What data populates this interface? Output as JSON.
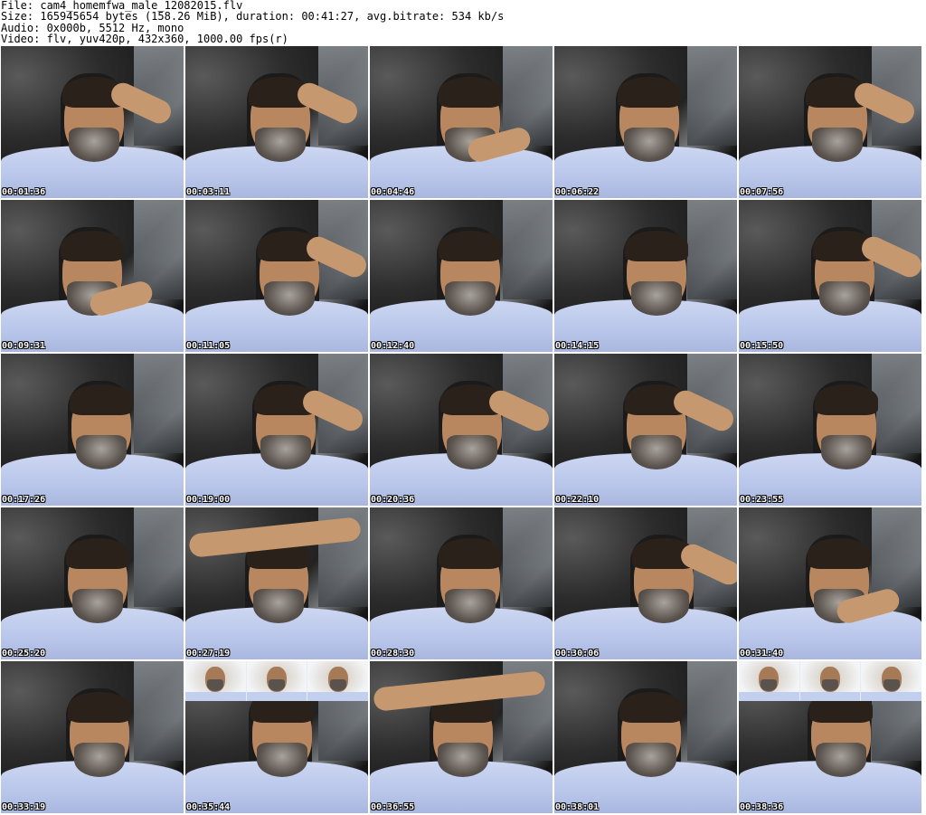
{
  "header": {
    "line1": "File: cam4_homemfwa_male_12082015.flv",
    "line2": "Size: 165945654 bytes (158.26 MiB), duration: 00:41:27, avg.bitrate: 534 kb/s",
    "line3": "Audio: 0x000b, 5512 Hz, mono",
    "line4": "Video: flv, yuv420p, 432x360, 1000.00 fps(r)"
  },
  "thumbnails": [
    {
      "timestamp": "00:01:36"
    },
    {
      "timestamp": "00:03:11"
    },
    {
      "timestamp": "00:04:46"
    },
    {
      "timestamp": "00:06:22"
    },
    {
      "timestamp": "00:07:56"
    },
    {
      "timestamp": "00:09:31"
    },
    {
      "timestamp": "00:11:05"
    },
    {
      "timestamp": "00:12:40"
    },
    {
      "timestamp": "00:14:15"
    },
    {
      "timestamp": "00:15:50"
    },
    {
      "timestamp": "00:17:26"
    },
    {
      "timestamp": "00:19:00"
    },
    {
      "timestamp": "00:20:36"
    },
    {
      "timestamp": "00:22:10"
    },
    {
      "timestamp": "00:23:55"
    },
    {
      "timestamp": "00:25:20"
    },
    {
      "timestamp": "00:27:19"
    },
    {
      "timestamp": "00:28:30"
    },
    {
      "timestamp": "00:30:06"
    },
    {
      "timestamp": "00:31:40"
    },
    {
      "timestamp": "00:33:19"
    },
    {
      "timestamp": "00:35:44"
    },
    {
      "timestamp": "00:36:55"
    },
    {
      "timestamp": "00:38:01"
    },
    {
      "timestamp": "00:38:36"
    }
  ]
}
